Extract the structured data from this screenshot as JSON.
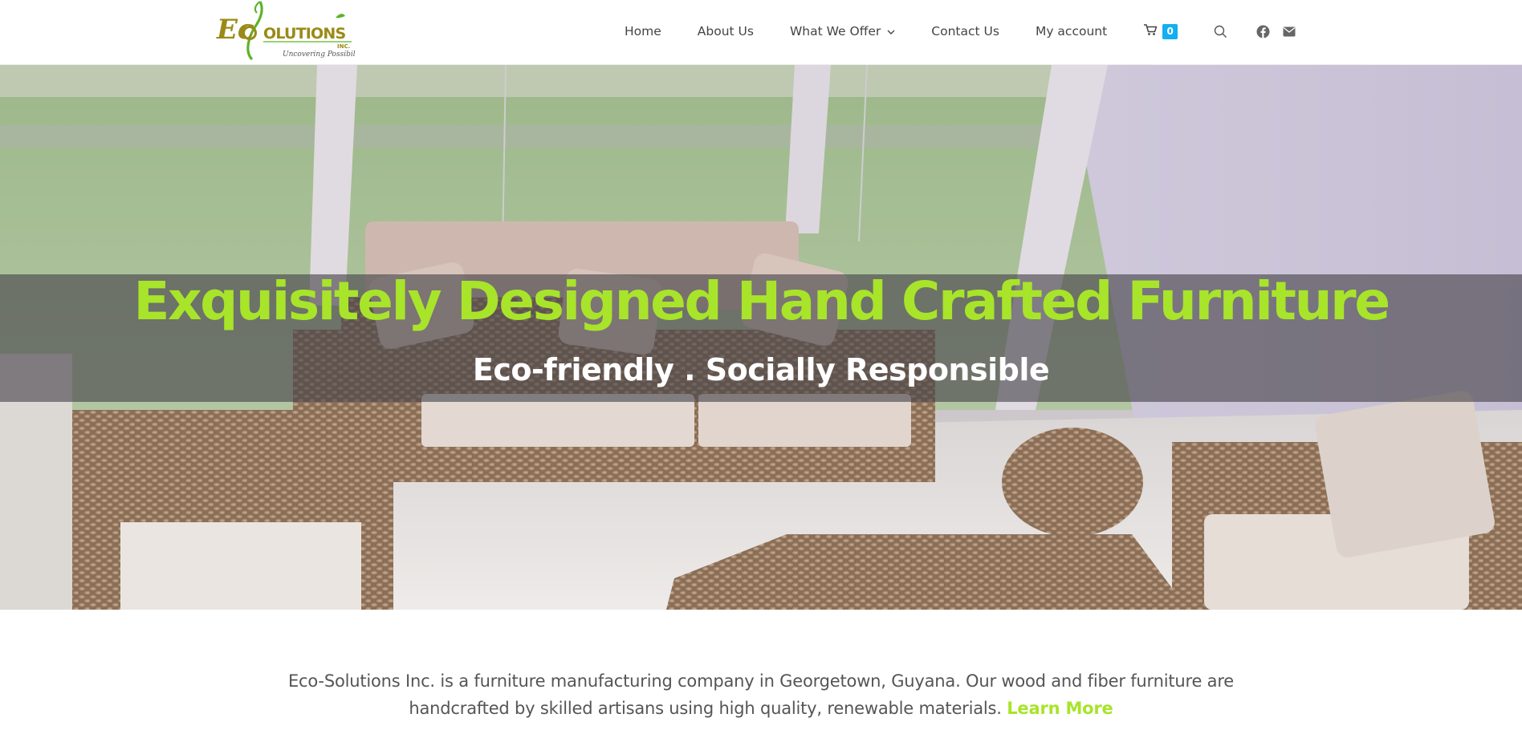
{
  "brand": {
    "logo_text_eco": "Ec",
    "logo_text_solutions": "OLUTIONS",
    "logo_text_inc": "INC.",
    "logo_tagline": "Uncovering Possibilities"
  },
  "nav": {
    "items": [
      {
        "label": "Home"
      },
      {
        "label": "About Us"
      },
      {
        "label": "What We Offer"
      },
      {
        "label": "Contact Us"
      },
      {
        "label": "My account"
      }
    ],
    "cart_count": "0"
  },
  "hero": {
    "title": "Exquisitely Designed Hand Crafted Furniture",
    "subtitle": "Eco-friendly . Socially Responsible"
  },
  "intro": {
    "text": "Eco-Solutions Inc. is a furniture manufacturing company in Georgetown, Guyana. Our wood and fiber furniture are handcrafted by skilled artisans using high quality, renewable materials.",
    "link_label": "Learn More"
  },
  "colors": {
    "accent_green": "#a8e42a",
    "cart_badge_blue": "#13aff0",
    "nav_text": "#444444",
    "body_text": "#555555"
  },
  "icons": [
    "chevron-down-icon",
    "cart-icon",
    "search-icon",
    "facebook-icon",
    "envelope-icon"
  ]
}
